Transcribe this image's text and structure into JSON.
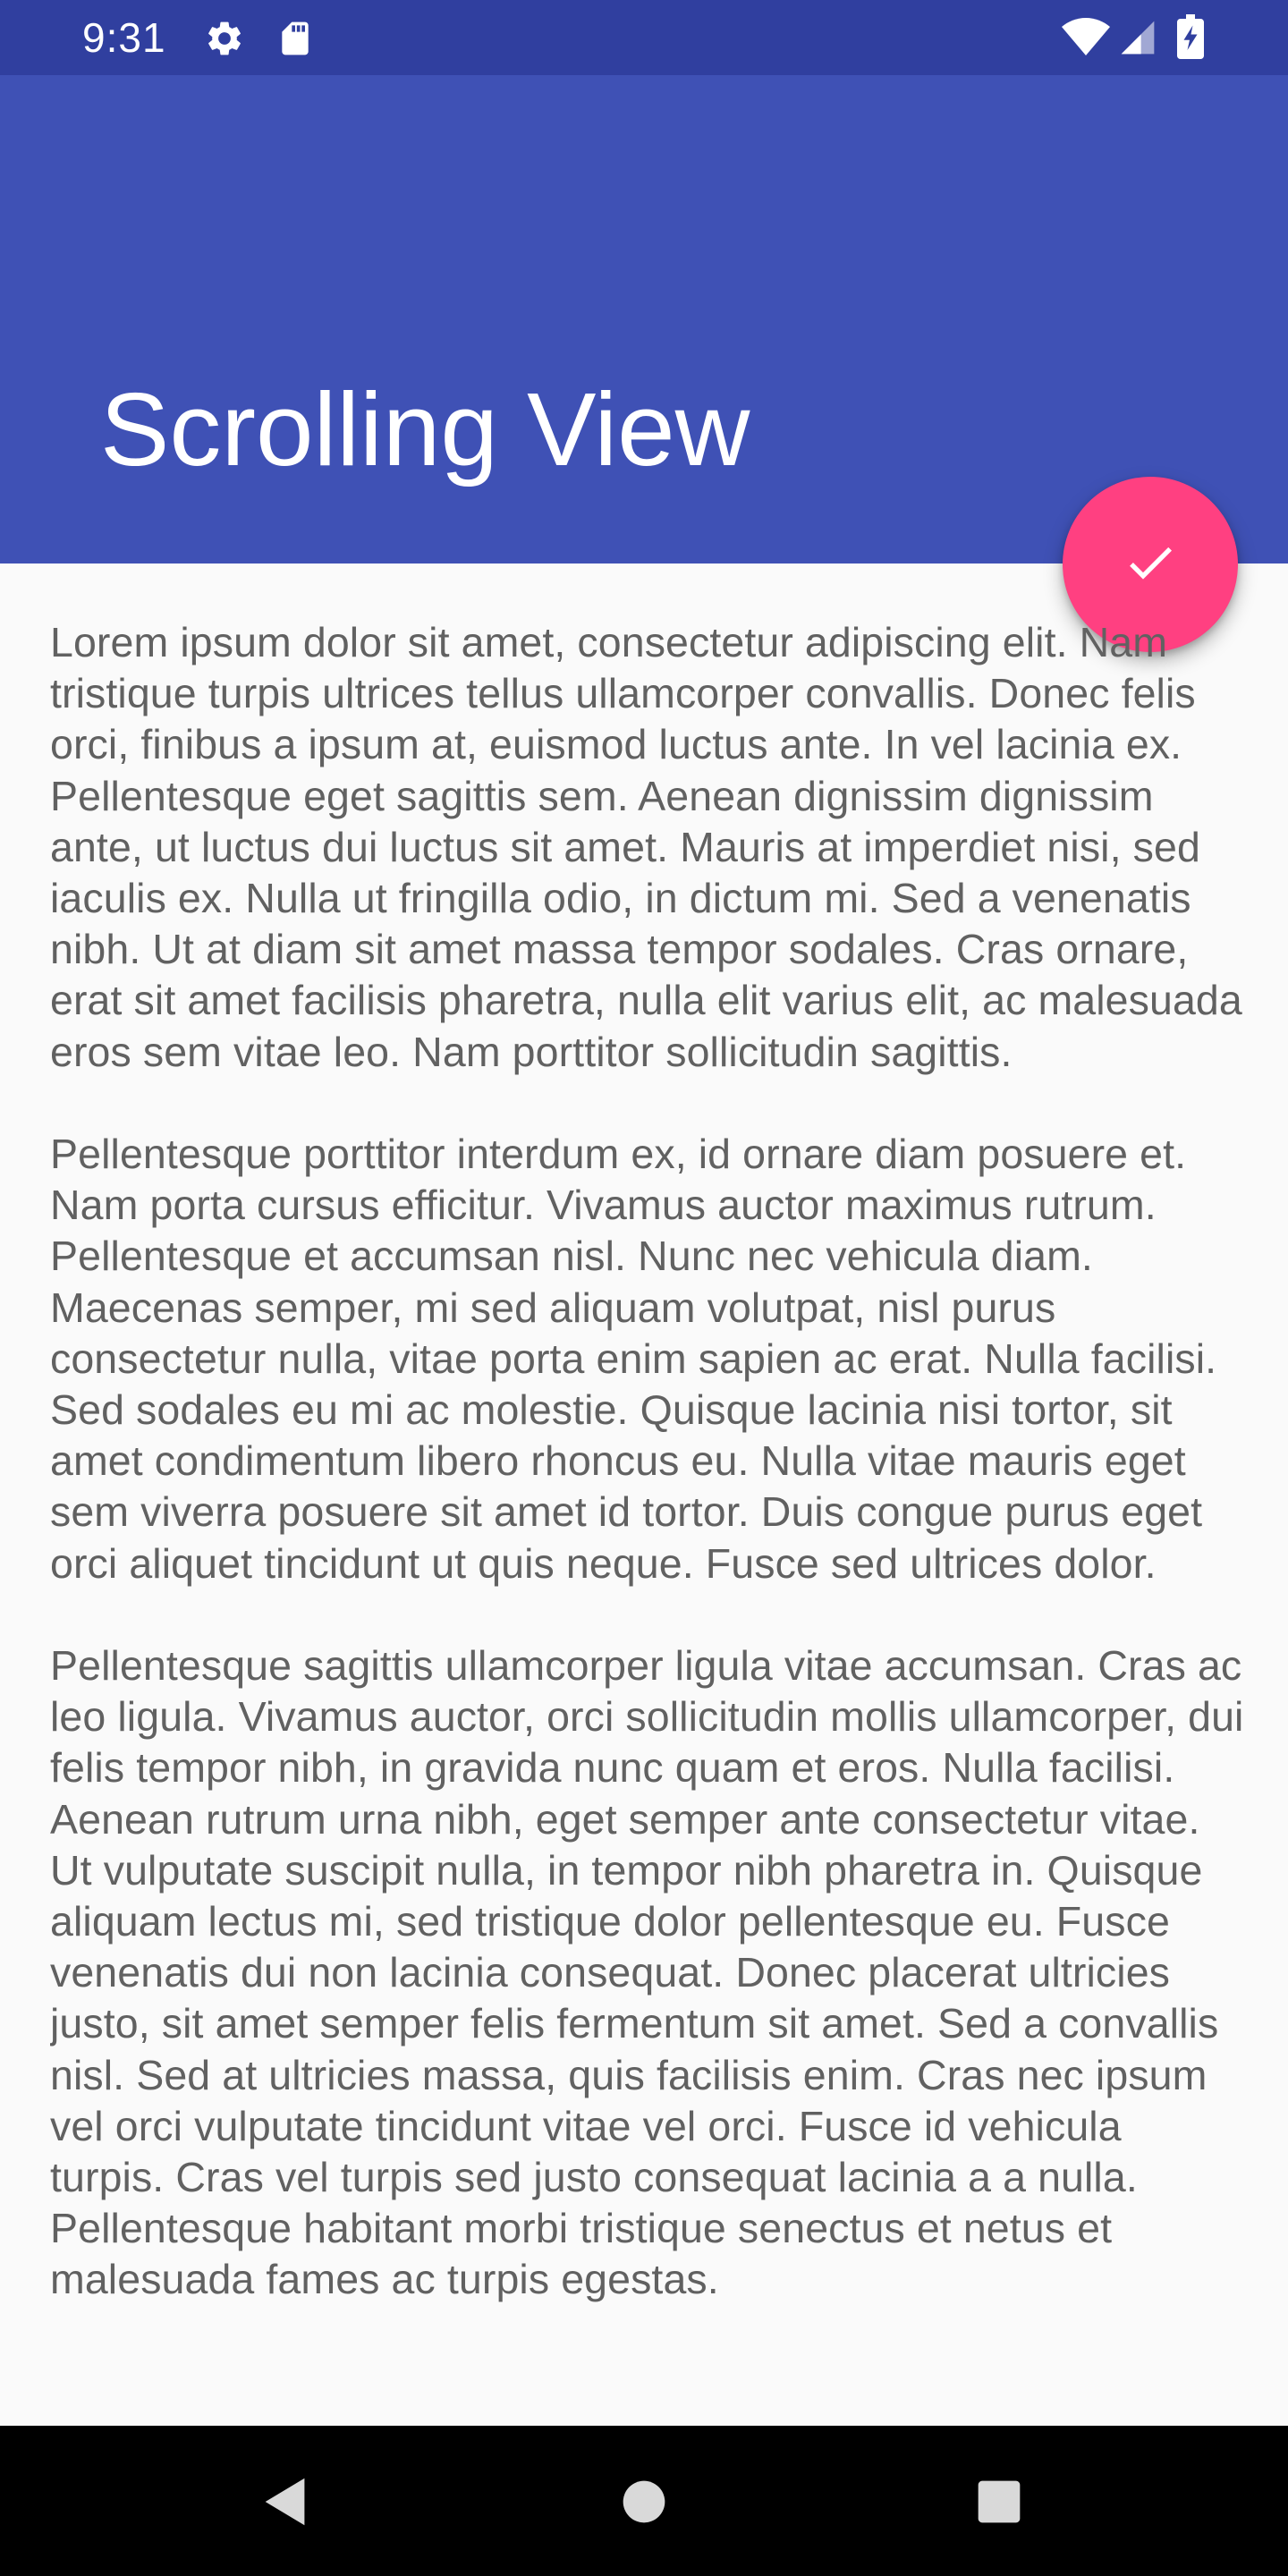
{
  "status_bar": {
    "time": "9:31",
    "icons": [
      "gear-icon",
      "sd-card-icon",
      "wifi-icon",
      "signal-icon",
      "battery-charging-icon"
    ]
  },
  "app_bar": {
    "title": "Scrolling View"
  },
  "fab": {
    "icon": "check-icon",
    "color": "#ff4081"
  },
  "content": {
    "paragraphs": [
      "Lorem ipsum dolor sit amet, consectetur adipiscing elit. Nam tristique turpis ultrices tellus ullamcorper convallis. Donec felis orci, finibus a ipsum at, euismod luctus ante. In vel lacinia ex. Pellentesque eget sagittis sem. Aenean dignissim dignissim ante, ut luctus dui luctus sit amet. Mauris at imperdiet nisi, sed iaculis ex. Nulla ut fringilla odio, in dictum mi. Sed a venenatis nibh. Ut at diam sit amet massa tempor sodales. Cras ornare, erat sit amet facilisis pharetra, nulla elit varius elit, ac malesuada eros sem vitae leo. Nam porttitor sollicitudin sagittis.",
      "Pellentesque porttitor interdum ex, id ornare diam posuere et. Nam porta cursus efficitur. Vivamus auctor maximus rutrum. Pellentesque et accumsan nisl. Nunc nec vehicula diam. Maecenas semper, mi sed aliquam volutpat, nisl purus consectetur nulla, vitae porta enim sapien ac erat. Nulla facilisi. Sed sodales eu mi ac molestie. Quisque lacinia nisi tortor, sit amet condimentum libero rhoncus eu. Nulla vitae mauris eget sem viverra posuere sit amet id tortor. Duis congue purus eget orci aliquet tincidunt ut quis neque. Fusce sed ultrices dolor.",
      "Pellentesque sagittis ullamcorper ligula vitae accumsan. Cras ac leo ligula. Vivamus auctor, orci sollicitudin mollis ullamcorper, dui felis tempor nibh, in gravida nunc quam et eros. Nulla facilisi. Aenean rutrum urna nibh, eget semper ante consectetur vitae. Ut vulputate suscipit nulla, in tempor nibh pharetra in. Quisque aliquam lectus mi, sed tristique dolor pellentesque eu. Fusce venenatis dui non lacinia consequat. Donec placerat ultricies justo, sit amet semper felis fermentum sit amet. Sed a convallis nisl. Sed at ultricies massa, quis facilisis enim. Cras nec ipsum vel orci vulputate tincidunt vitae vel orci. Fusce id vehicula turpis. Cras vel turpis sed justo consequat lacinia a a nulla. Pellentesque habitant morbi tristique senectus et netus et malesuada fames ac turpis egestas."
    ]
  },
  "nav_bar": {
    "buttons": [
      "back-icon",
      "home-icon",
      "recents-icon"
    ]
  },
  "colors": {
    "status_bar": "#303f9f",
    "primary": "#3f51b5",
    "accent": "#ff4081",
    "body_text": "#616161",
    "background": "#fafafa"
  }
}
